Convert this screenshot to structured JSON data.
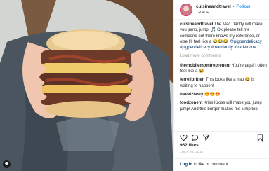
{
  "post": {
    "username": "cuisineandtravel",
    "separator": "•",
    "follow_label": "Follow",
    "location": "TRADE",
    "caption": {
      "username": "cuisineandtravel",
      "text_1": "The Mac Daddy will make you jump, jump!",
      "text_2": "🎵 Ok please tell me someone out there knows my reference, or else I'll feel like a 😂😂😂",
      "hashtags": "@pigpendelicacy #pigpendelicacy #macdaddy #tradeirvine"
    },
    "load_more": "Load more comments",
    "comments": [
      {
        "user": "themobilemomtrepreneur",
        "text": "You're tags! I often feel like a 😂"
      },
      {
        "user": "terrellbritten",
        "text": "This looks like a nap 😂 is waiting to happen!"
      },
      {
        "user": "travel2tasty",
        "text": "😍😍😍"
      },
      {
        "user": "foodzoneht",
        "text": "Kriss Kross will make you jump jump! And this burger makes me jump too!"
      }
    ],
    "likes": "962 likes",
    "date": "JULY 20, 2017",
    "login_link": "Log in",
    "login_text": "to like or comment.",
    "accent_color": "#3897f0"
  }
}
